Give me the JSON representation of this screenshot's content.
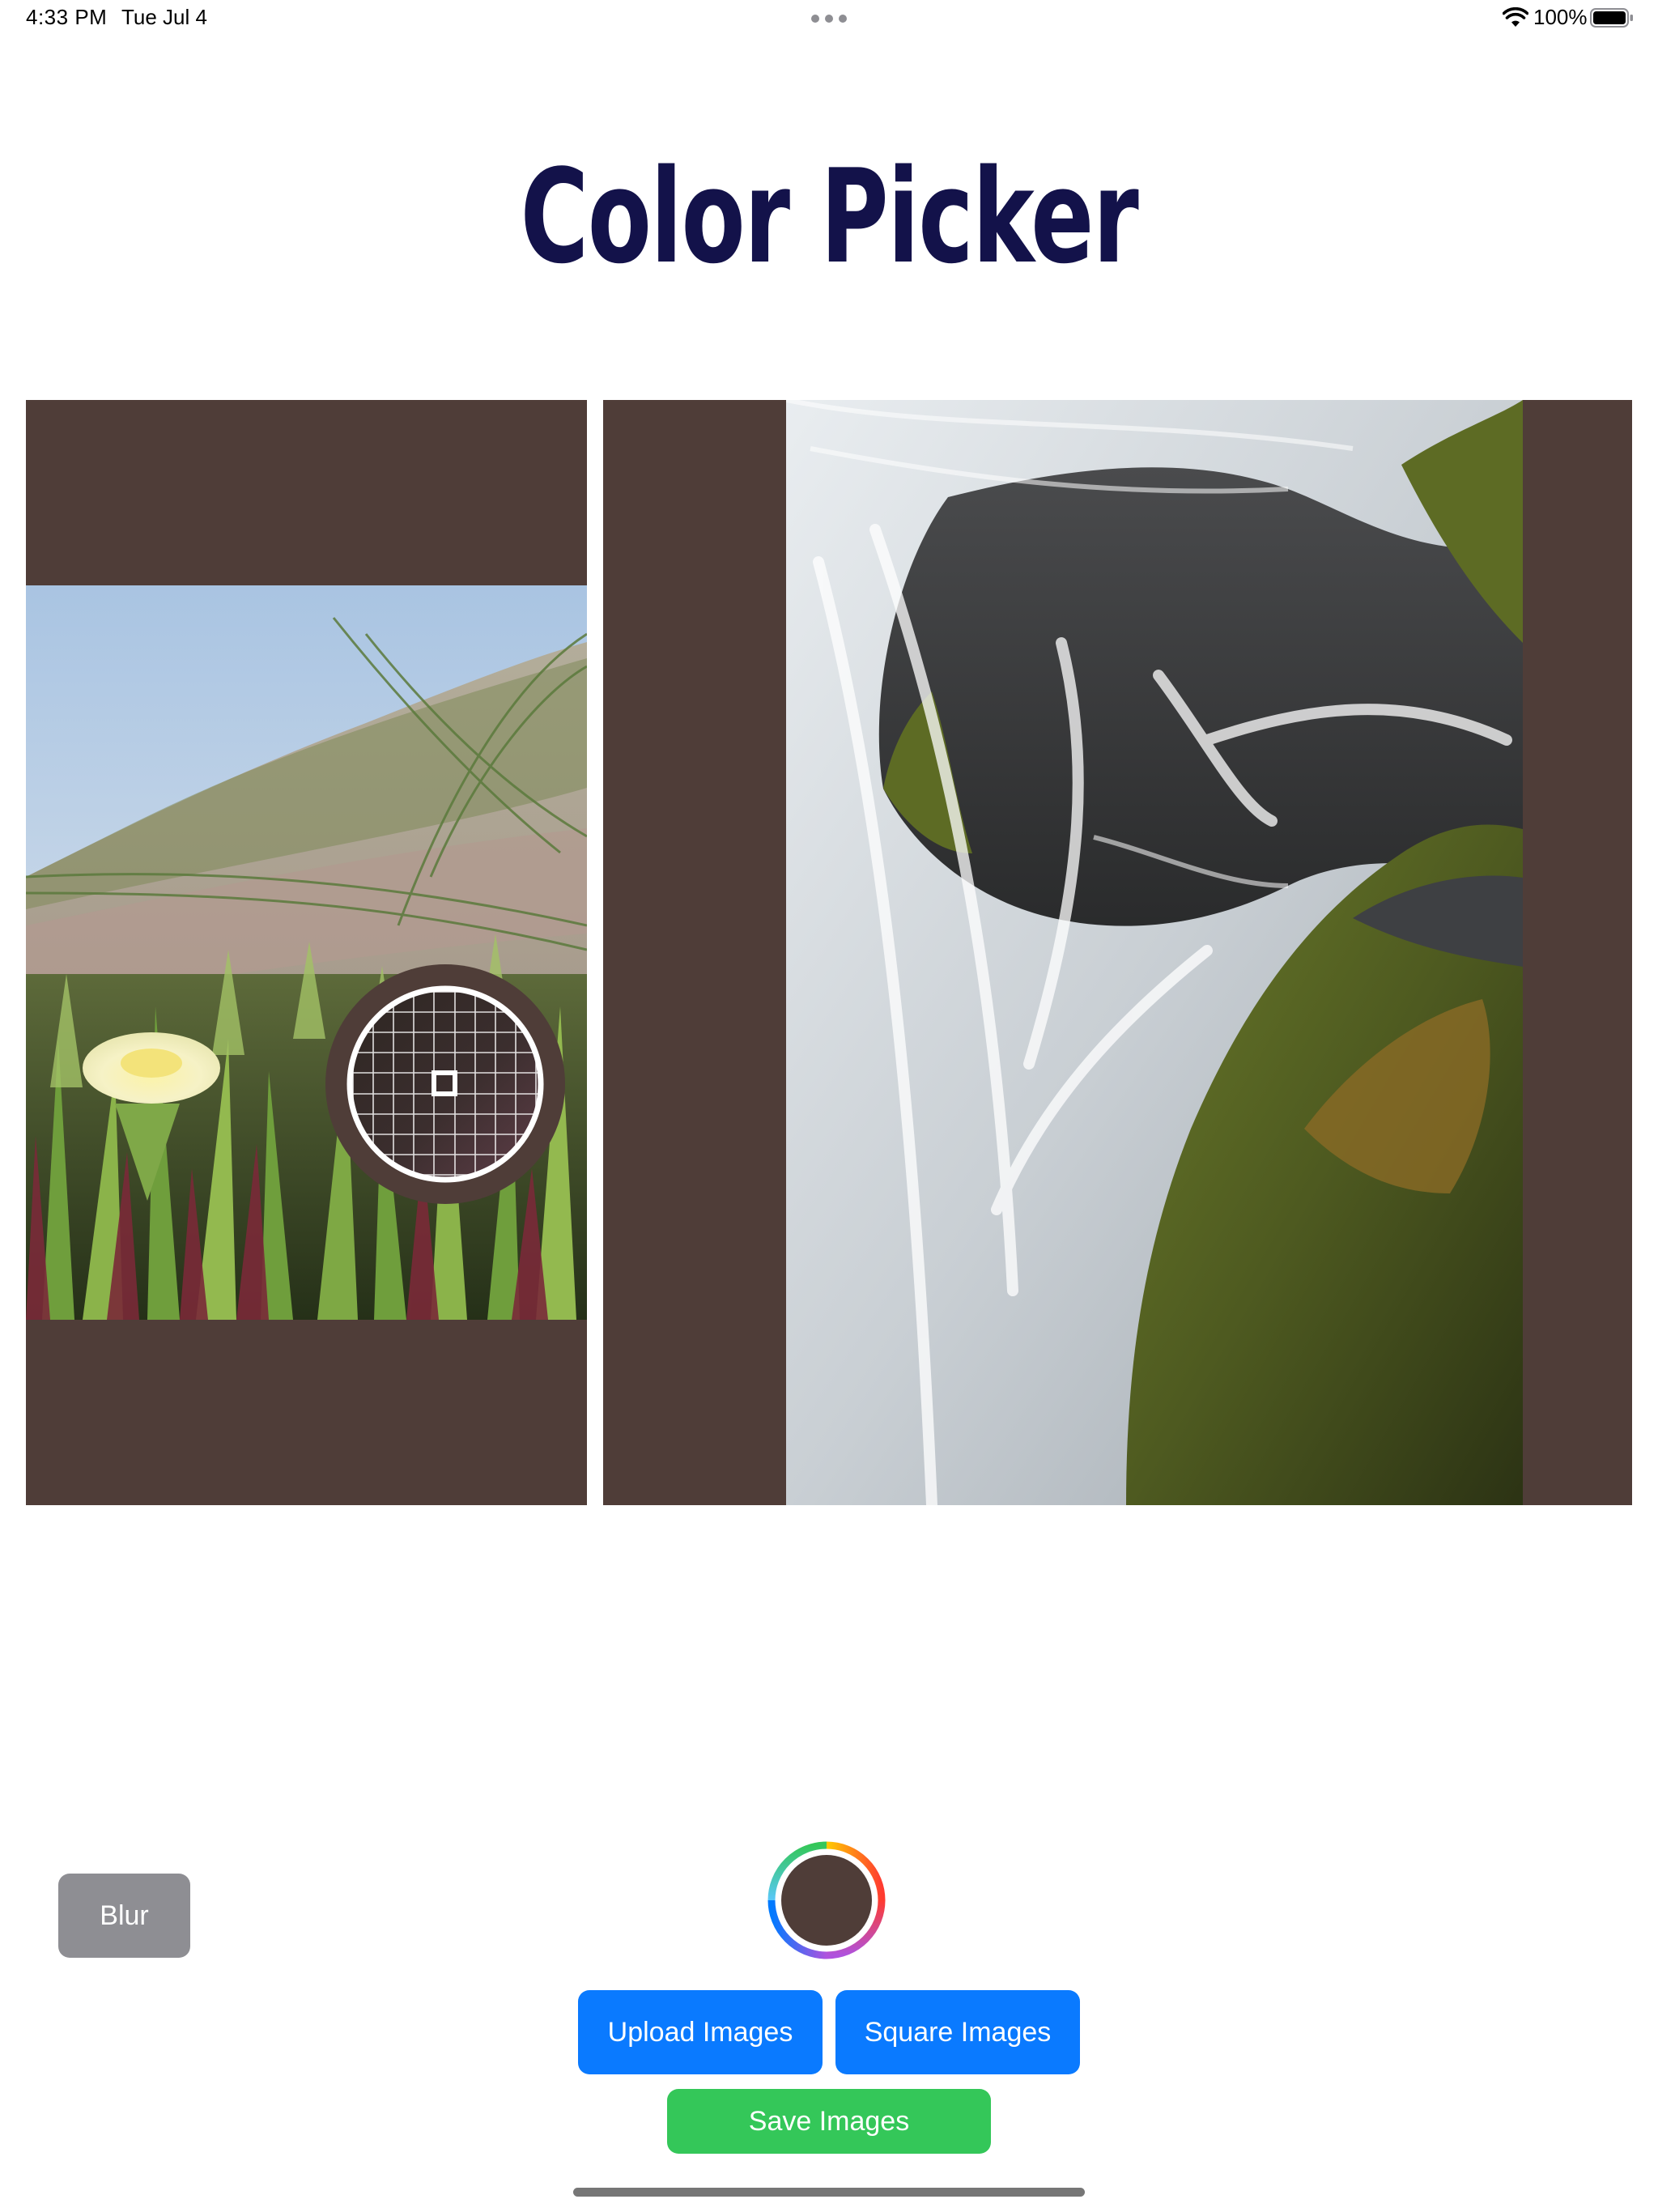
{
  "status_bar": {
    "time": "4:33 PM",
    "date": "Tue Jul 4",
    "battery": "100%",
    "icons": [
      "multitasking-dots-icon",
      "wifi-icon",
      "battery-icon"
    ]
  },
  "title": "Color Picker",
  "panes": {
    "left": {
      "image": "ice-plant-flower-photo",
      "background_color": "#4f3d38"
    },
    "right": {
      "image": "mossy-waterfall-photo",
      "background_color": "#4f3d38"
    }
  },
  "loupe": {
    "icon": "color-loupe-icon",
    "selected_color": "#4f3d38"
  },
  "controls": {
    "blur_label": "Blur",
    "color_well_icon": "color-well-icon",
    "selected_color": "#4f3d38",
    "upload_label": "Upload Images",
    "square_label": "Square Images",
    "save_label": "Save Images"
  },
  "colors": {
    "title": "#13124a",
    "pane_background": "#4f3d38",
    "primary_button": "#0a7aff",
    "save_button": "#34c759",
    "blur_button": "#8e8e93"
  }
}
